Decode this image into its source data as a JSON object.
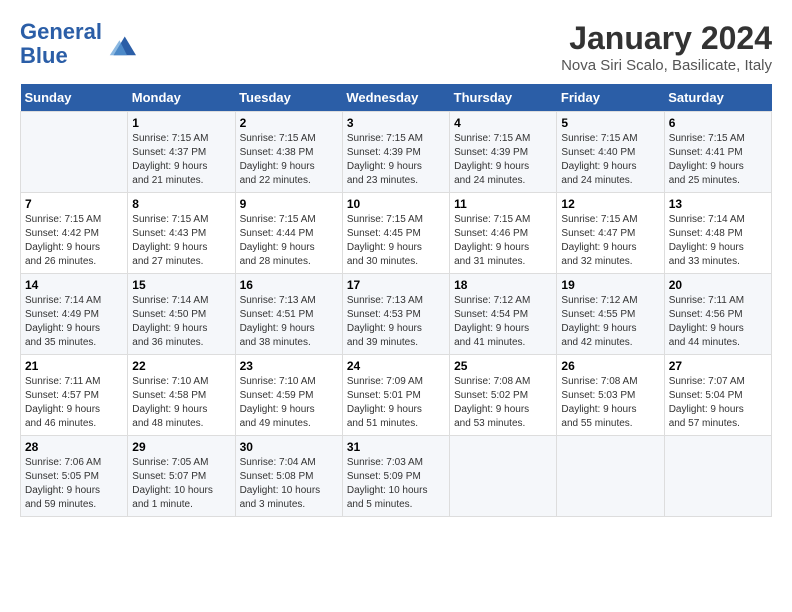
{
  "header": {
    "logo_line1": "General",
    "logo_line2": "Blue",
    "title": "January 2024",
    "subtitle": "Nova Siri Scalo, Basilicate, Italy"
  },
  "days_of_week": [
    "Sunday",
    "Monday",
    "Tuesday",
    "Wednesday",
    "Thursday",
    "Friday",
    "Saturday"
  ],
  "weeks": [
    [
      {
        "num": "",
        "info": ""
      },
      {
        "num": "1",
        "info": "Sunrise: 7:15 AM\nSunset: 4:37 PM\nDaylight: 9 hours\nand 21 minutes."
      },
      {
        "num": "2",
        "info": "Sunrise: 7:15 AM\nSunset: 4:38 PM\nDaylight: 9 hours\nand 22 minutes."
      },
      {
        "num": "3",
        "info": "Sunrise: 7:15 AM\nSunset: 4:39 PM\nDaylight: 9 hours\nand 23 minutes."
      },
      {
        "num": "4",
        "info": "Sunrise: 7:15 AM\nSunset: 4:39 PM\nDaylight: 9 hours\nand 24 minutes."
      },
      {
        "num": "5",
        "info": "Sunrise: 7:15 AM\nSunset: 4:40 PM\nDaylight: 9 hours\nand 24 minutes."
      },
      {
        "num": "6",
        "info": "Sunrise: 7:15 AM\nSunset: 4:41 PM\nDaylight: 9 hours\nand 25 minutes."
      }
    ],
    [
      {
        "num": "7",
        "info": "Sunrise: 7:15 AM\nSunset: 4:42 PM\nDaylight: 9 hours\nand 26 minutes."
      },
      {
        "num": "8",
        "info": "Sunrise: 7:15 AM\nSunset: 4:43 PM\nDaylight: 9 hours\nand 27 minutes."
      },
      {
        "num": "9",
        "info": "Sunrise: 7:15 AM\nSunset: 4:44 PM\nDaylight: 9 hours\nand 28 minutes."
      },
      {
        "num": "10",
        "info": "Sunrise: 7:15 AM\nSunset: 4:45 PM\nDaylight: 9 hours\nand 30 minutes."
      },
      {
        "num": "11",
        "info": "Sunrise: 7:15 AM\nSunset: 4:46 PM\nDaylight: 9 hours\nand 31 minutes."
      },
      {
        "num": "12",
        "info": "Sunrise: 7:15 AM\nSunset: 4:47 PM\nDaylight: 9 hours\nand 32 minutes."
      },
      {
        "num": "13",
        "info": "Sunrise: 7:14 AM\nSunset: 4:48 PM\nDaylight: 9 hours\nand 33 minutes."
      }
    ],
    [
      {
        "num": "14",
        "info": "Sunrise: 7:14 AM\nSunset: 4:49 PM\nDaylight: 9 hours\nand 35 minutes."
      },
      {
        "num": "15",
        "info": "Sunrise: 7:14 AM\nSunset: 4:50 PM\nDaylight: 9 hours\nand 36 minutes."
      },
      {
        "num": "16",
        "info": "Sunrise: 7:13 AM\nSunset: 4:51 PM\nDaylight: 9 hours\nand 38 minutes."
      },
      {
        "num": "17",
        "info": "Sunrise: 7:13 AM\nSunset: 4:53 PM\nDaylight: 9 hours\nand 39 minutes."
      },
      {
        "num": "18",
        "info": "Sunrise: 7:12 AM\nSunset: 4:54 PM\nDaylight: 9 hours\nand 41 minutes."
      },
      {
        "num": "19",
        "info": "Sunrise: 7:12 AM\nSunset: 4:55 PM\nDaylight: 9 hours\nand 42 minutes."
      },
      {
        "num": "20",
        "info": "Sunrise: 7:11 AM\nSunset: 4:56 PM\nDaylight: 9 hours\nand 44 minutes."
      }
    ],
    [
      {
        "num": "21",
        "info": "Sunrise: 7:11 AM\nSunset: 4:57 PM\nDaylight: 9 hours\nand 46 minutes."
      },
      {
        "num": "22",
        "info": "Sunrise: 7:10 AM\nSunset: 4:58 PM\nDaylight: 9 hours\nand 48 minutes."
      },
      {
        "num": "23",
        "info": "Sunrise: 7:10 AM\nSunset: 4:59 PM\nDaylight: 9 hours\nand 49 minutes."
      },
      {
        "num": "24",
        "info": "Sunrise: 7:09 AM\nSunset: 5:01 PM\nDaylight: 9 hours\nand 51 minutes."
      },
      {
        "num": "25",
        "info": "Sunrise: 7:08 AM\nSunset: 5:02 PM\nDaylight: 9 hours\nand 53 minutes."
      },
      {
        "num": "26",
        "info": "Sunrise: 7:08 AM\nSunset: 5:03 PM\nDaylight: 9 hours\nand 55 minutes."
      },
      {
        "num": "27",
        "info": "Sunrise: 7:07 AM\nSunset: 5:04 PM\nDaylight: 9 hours\nand 57 minutes."
      }
    ],
    [
      {
        "num": "28",
        "info": "Sunrise: 7:06 AM\nSunset: 5:05 PM\nDaylight: 9 hours\nand 59 minutes."
      },
      {
        "num": "29",
        "info": "Sunrise: 7:05 AM\nSunset: 5:07 PM\nDaylight: 10 hours\nand 1 minute."
      },
      {
        "num": "30",
        "info": "Sunrise: 7:04 AM\nSunset: 5:08 PM\nDaylight: 10 hours\nand 3 minutes."
      },
      {
        "num": "31",
        "info": "Sunrise: 7:03 AM\nSunset: 5:09 PM\nDaylight: 10 hours\nand 5 minutes."
      },
      {
        "num": "",
        "info": ""
      },
      {
        "num": "",
        "info": ""
      },
      {
        "num": "",
        "info": ""
      }
    ]
  ]
}
